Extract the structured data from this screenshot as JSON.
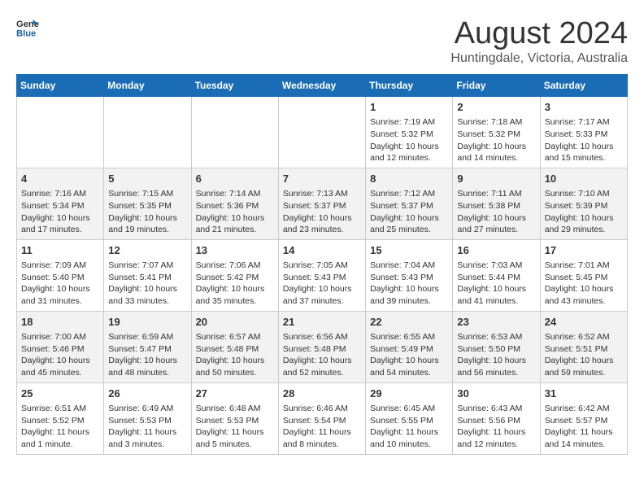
{
  "header": {
    "logo_line1": "General",
    "logo_line2": "Blue",
    "title": "August 2024",
    "subtitle": "Huntingdale, Victoria, Australia"
  },
  "days_of_week": [
    "Sunday",
    "Monday",
    "Tuesday",
    "Wednesday",
    "Thursday",
    "Friday",
    "Saturday"
  ],
  "weeks": [
    {
      "days": [
        {
          "num": "",
          "info": ""
        },
        {
          "num": "",
          "info": ""
        },
        {
          "num": "",
          "info": ""
        },
        {
          "num": "",
          "info": ""
        },
        {
          "num": "1",
          "info": "Sunrise: 7:19 AM\nSunset: 5:32 PM\nDaylight: 10 hours\nand 12 minutes."
        },
        {
          "num": "2",
          "info": "Sunrise: 7:18 AM\nSunset: 5:32 PM\nDaylight: 10 hours\nand 14 minutes."
        },
        {
          "num": "3",
          "info": "Sunrise: 7:17 AM\nSunset: 5:33 PM\nDaylight: 10 hours\nand 15 minutes."
        }
      ]
    },
    {
      "days": [
        {
          "num": "4",
          "info": "Sunrise: 7:16 AM\nSunset: 5:34 PM\nDaylight: 10 hours\nand 17 minutes."
        },
        {
          "num": "5",
          "info": "Sunrise: 7:15 AM\nSunset: 5:35 PM\nDaylight: 10 hours\nand 19 minutes."
        },
        {
          "num": "6",
          "info": "Sunrise: 7:14 AM\nSunset: 5:36 PM\nDaylight: 10 hours\nand 21 minutes."
        },
        {
          "num": "7",
          "info": "Sunrise: 7:13 AM\nSunset: 5:37 PM\nDaylight: 10 hours\nand 23 minutes."
        },
        {
          "num": "8",
          "info": "Sunrise: 7:12 AM\nSunset: 5:37 PM\nDaylight: 10 hours\nand 25 minutes."
        },
        {
          "num": "9",
          "info": "Sunrise: 7:11 AM\nSunset: 5:38 PM\nDaylight: 10 hours\nand 27 minutes."
        },
        {
          "num": "10",
          "info": "Sunrise: 7:10 AM\nSunset: 5:39 PM\nDaylight: 10 hours\nand 29 minutes."
        }
      ]
    },
    {
      "days": [
        {
          "num": "11",
          "info": "Sunrise: 7:09 AM\nSunset: 5:40 PM\nDaylight: 10 hours\nand 31 minutes."
        },
        {
          "num": "12",
          "info": "Sunrise: 7:07 AM\nSunset: 5:41 PM\nDaylight: 10 hours\nand 33 minutes."
        },
        {
          "num": "13",
          "info": "Sunrise: 7:06 AM\nSunset: 5:42 PM\nDaylight: 10 hours\nand 35 minutes."
        },
        {
          "num": "14",
          "info": "Sunrise: 7:05 AM\nSunset: 5:43 PM\nDaylight: 10 hours\nand 37 minutes."
        },
        {
          "num": "15",
          "info": "Sunrise: 7:04 AM\nSunset: 5:43 PM\nDaylight: 10 hours\nand 39 minutes."
        },
        {
          "num": "16",
          "info": "Sunrise: 7:03 AM\nSunset: 5:44 PM\nDaylight: 10 hours\nand 41 minutes."
        },
        {
          "num": "17",
          "info": "Sunrise: 7:01 AM\nSunset: 5:45 PM\nDaylight: 10 hours\nand 43 minutes."
        }
      ]
    },
    {
      "days": [
        {
          "num": "18",
          "info": "Sunrise: 7:00 AM\nSunset: 5:46 PM\nDaylight: 10 hours\nand 45 minutes."
        },
        {
          "num": "19",
          "info": "Sunrise: 6:59 AM\nSunset: 5:47 PM\nDaylight: 10 hours\nand 48 minutes."
        },
        {
          "num": "20",
          "info": "Sunrise: 6:57 AM\nSunset: 5:48 PM\nDaylight: 10 hours\nand 50 minutes."
        },
        {
          "num": "21",
          "info": "Sunrise: 6:56 AM\nSunset: 5:48 PM\nDaylight: 10 hours\nand 52 minutes."
        },
        {
          "num": "22",
          "info": "Sunrise: 6:55 AM\nSunset: 5:49 PM\nDaylight: 10 hours\nand 54 minutes."
        },
        {
          "num": "23",
          "info": "Sunrise: 6:53 AM\nSunset: 5:50 PM\nDaylight: 10 hours\nand 56 minutes."
        },
        {
          "num": "24",
          "info": "Sunrise: 6:52 AM\nSunset: 5:51 PM\nDaylight: 10 hours\nand 59 minutes."
        }
      ]
    },
    {
      "days": [
        {
          "num": "25",
          "info": "Sunrise: 6:51 AM\nSunset: 5:52 PM\nDaylight: 11 hours\nand 1 minute."
        },
        {
          "num": "26",
          "info": "Sunrise: 6:49 AM\nSunset: 5:53 PM\nDaylight: 11 hours\nand 3 minutes."
        },
        {
          "num": "27",
          "info": "Sunrise: 6:48 AM\nSunset: 5:53 PM\nDaylight: 11 hours\nand 5 minutes."
        },
        {
          "num": "28",
          "info": "Sunrise: 6:46 AM\nSunset: 5:54 PM\nDaylight: 11 hours\nand 8 minutes."
        },
        {
          "num": "29",
          "info": "Sunrise: 6:45 AM\nSunset: 5:55 PM\nDaylight: 11 hours\nand 10 minutes."
        },
        {
          "num": "30",
          "info": "Sunrise: 6:43 AM\nSunset: 5:56 PM\nDaylight: 11 hours\nand 12 minutes."
        },
        {
          "num": "31",
          "info": "Sunrise: 6:42 AM\nSunset: 5:57 PM\nDaylight: 11 hours\nand 14 minutes."
        }
      ]
    }
  ]
}
